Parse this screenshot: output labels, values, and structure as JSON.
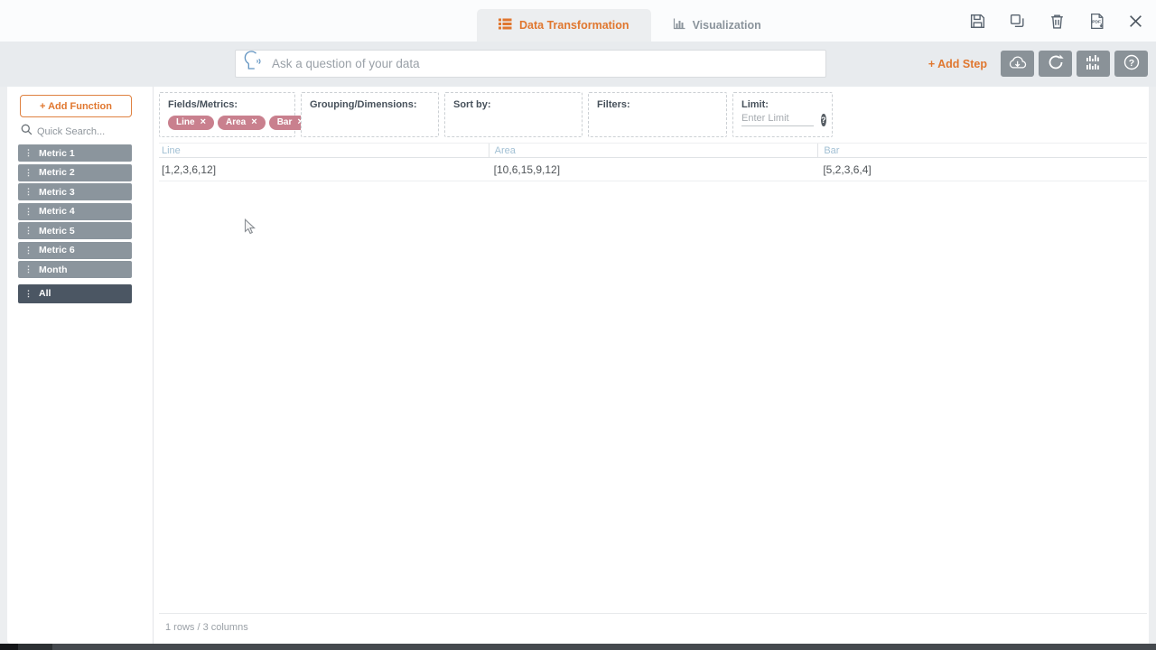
{
  "colors": {
    "accent_orange": "#e0772f",
    "pill_rose": "#c9808e",
    "field_gray": "#8b959d",
    "field_dark": "#4b5663",
    "table_header_blue": "#a2c0d4",
    "toolbar_button_gray": "#8a9298",
    "icon_slate": "#57626e"
  },
  "glyphs": {
    "pill_close": "×",
    "question": "?",
    "grip": "⋮",
    "pdf": "PDF"
  },
  "titlebar": {
    "tabs": [
      {
        "label": "Data Transformation",
        "active": true
      },
      {
        "label": "Visualization",
        "active": false
      }
    ]
  },
  "toolbar": {
    "search_placeholder": "Ask a question of your data",
    "add_step_label": "+ Add Step"
  },
  "sidebar": {
    "add_function_label": "+ Add Function",
    "quick_search_placeholder": "Quick Search...",
    "fields": [
      {
        "label": "Metric 1"
      },
      {
        "label": "Metric 2"
      },
      {
        "label": "Metric 3"
      },
      {
        "label": "Metric 4"
      },
      {
        "label": "Metric 5"
      },
      {
        "label": "Metric 6"
      },
      {
        "label": "Month"
      },
      {
        "label": "All"
      }
    ]
  },
  "query_builder": {
    "fields_metrics_label": "Fields/Metrics:",
    "pills": [
      {
        "label": "Line"
      },
      {
        "label": "Area"
      },
      {
        "label": "Bar"
      }
    ],
    "grouping_label": "Grouping/Dimensions:",
    "sort_by_label": "Sort by:",
    "filters_label": "Filters:",
    "limit_label": "Limit:",
    "limit_placeholder": "Enter Limit"
  },
  "table": {
    "columns": [
      "Line",
      "Area",
      "Bar"
    ],
    "rows": [
      [
        "[1,2,3,6,12]",
        "[10,6,15,9,12]",
        "[5,2,3,6,4]"
      ]
    ],
    "status": "1 rows / 3 columns"
  }
}
